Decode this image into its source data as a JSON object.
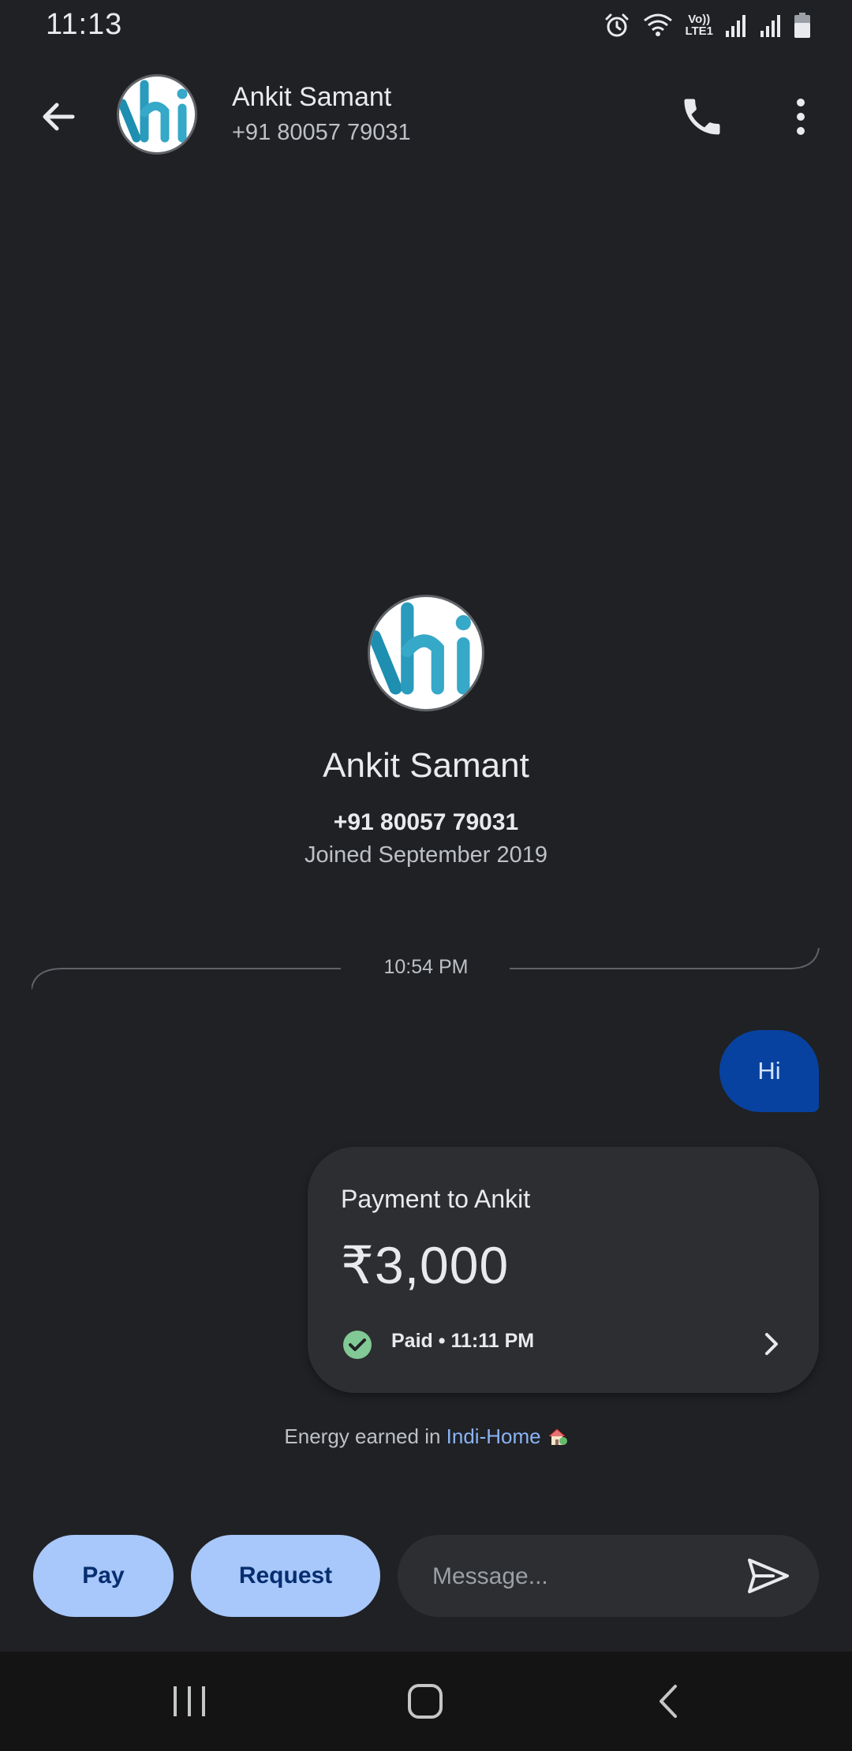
{
  "status_bar": {
    "time": "11:13",
    "network_label_top": "Vo))",
    "network_label_bottom": "LTE1"
  },
  "header": {
    "contact_name": "Ankit Samant",
    "contact_phone": "+91 80057 79031",
    "avatar_text": "hi"
  },
  "profile": {
    "name": "Ankit Samant",
    "phone": "+91 80057 79031",
    "joined": "Joined September 2019",
    "avatar_text": "hi"
  },
  "conversation": {
    "timestamp": "10:54 PM",
    "messages": [
      {
        "text": "Hi",
        "direction": "outgoing"
      }
    ],
    "payment": {
      "title": "Payment to Ankit",
      "amount": "₹3,000",
      "status": "Paid • 11:11 PM"
    }
  },
  "energy": {
    "prefix": "Energy earned in ",
    "link": "Indi-Home"
  },
  "composer": {
    "pay_label": "Pay",
    "request_label": "Request",
    "placeholder": "Message..."
  },
  "colors": {
    "background": "#202124",
    "bubble": "#0842a0",
    "card": "#2d2e31",
    "accent_button": "#a8c7fa",
    "link": "#8ab4f8",
    "paid_check": "#81c995"
  }
}
